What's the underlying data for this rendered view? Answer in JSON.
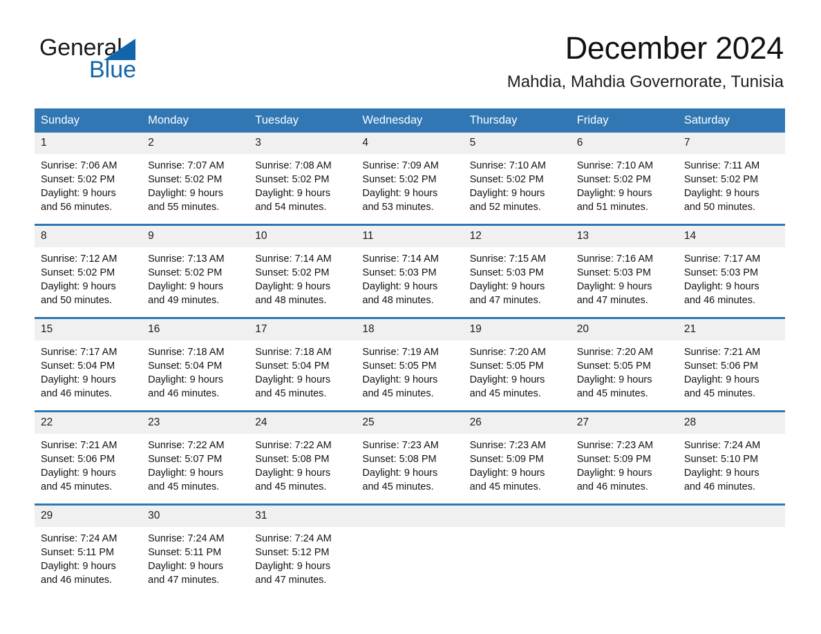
{
  "brand": {
    "word_one": "General",
    "word_two": "Blue",
    "accent_color": "#1166ab",
    "triangle_icon": "brand-triangle-icon"
  },
  "header": {
    "month_title": "December 2024",
    "location": "Mahdia, Mahdia Governorate, Tunisia"
  },
  "theme": {
    "header_blue": "#3077b4",
    "row_border_blue": "#2e76b4",
    "daynum_band": "#f0f0f0",
    "page_background": "#ffffff"
  },
  "calendar": {
    "weekday_headers": [
      "Sunday",
      "Monday",
      "Tuesday",
      "Wednesday",
      "Thursday",
      "Friday",
      "Saturday"
    ],
    "weeks": [
      [
        {
          "day": "1",
          "sunrise": "Sunrise: 7:06 AM",
          "sunset": "Sunset: 5:02 PM",
          "daylight_line1": "Daylight: 9 hours",
          "daylight_line2": "and 56 minutes."
        },
        {
          "day": "2",
          "sunrise": "Sunrise: 7:07 AM",
          "sunset": "Sunset: 5:02 PM",
          "daylight_line1": "Daylight: 9 hours",
          "daylight_line2": "and 55 minutes."
        },
        {
          "day": "3",
          "sunrise": "Sunrise: 7:08 AM",
          "sunset": "Sunset: 5:02 PM",
          "daylight_line1": "Daylight: 9 hours",
          "daylight_line2": "and 54 minutes."
        },
        {
          "day": "4",
          "sunrise": "Sunrise: 7:09 AM",
          "sunset": "Sunset: 5:02 PM",
          "daylight_line1": "Daylight: 9 hours",
          "daylight_line2": "and 53 minutes."
        },
        {
          "day": "5",
          "sunrise": "Sunrise: 7:10 AM",
          "sunset": "Sunset: 5:02 PM",
          "daylight_line1": "Daylight: 9 hours",
          "daylight_line2": "and 52 minutes."
        },
        {
          "day": "6",
          "sunrise": "Sunrise: 7:10 AM",
          "sunset": "Sunset: 5:02 PM",
          "daylight_line1": "Daylight: 9 hours",
          "daylight_line2": "and 51 minutes."
        },
        {
          "day": "7",
          "sunrise": "Sunrise: 7:11 AM",
          "sunset": "Sunset: 5:02 PM",
          "daylight_line1": "Daylight: 9 hours",
          "daylight_line2": "and 50 minutes."
        }
      ],
      [
        {
          "day": "8",
          "sunrise": "Sunrise: 7:12 AM",
          "sunset": "Sunset: 5:02 PM",
          "daylight_line1": "Daylight: 9 hours",
          "daylight_line2": "and 50 minutes."
        },
        {
          "day": "9",
          "sunrise": "Sunrise: 7:13 AM",
          "sunset": "Sunset: 5:02 PM",
          "daylight_line1": "Daylight: 9 hours",
          "daylight_line2": "and 49 minutes."
        },
        {
          "day": "10",
          "sunrise": "Sunrise: 7:14 AM",
          "sunset": "Sunset: 5:02 PM",
          "daylight_line1": "Daylight: 9 hours",
          "daylight_line2": "and 48 minutes."
        },
        {
          "day": "11",
          "sunrise": "Sunrise: 7:14 AM",
          "sunset": "Sunset: 5:03 PM",
          "daylight_line1": "Daylight: 9 hours",
          "daylight_line2": "and 48 minutes."
        },
        {
          "day": "12",
          "sunrise": "Sunrise: 7:15 AM",
          "sunset": "Sunset: 5:03 PM",
          "daylight_line1": "Daylight: 9 hours",
          "daylight_line2": "and 47 minutes."
        },
        {
          "day": "13",
          "sunrise": "Sunrise: 7:16 AM",
          "sunset": "Sunset: 5:03 PM",
          "daylight_line1": "Daylight: 9 hours",
          "daylight_line2": "and 47 minutes."
        },
        {
          "day": "14",
          "sunrise": "Sunrise: 7:17 AM",
          "sunset": "Sunset: 5:03 PM",
          "daylight_line1": "Daylight: 9 hours",
          "daylight_line2": "and 46 minutes."
        }
      ],
      [
        {
          "day": "15",
          "sunrise": "Sunrise: 7:17 AM",
          "sunset": "Sunset: 5:04 PM",
          "daylight_line1": "Daylight: 9 hours",
          "daylight_line2": "and 46 minutes."
        },
        {
          "day": "16",
          "sunrise": "Sunrise: 7:18 AM",
          "sunset": "Sunset: 5:04 PM",
          "daylight_line1": "Daylight: 9 hours",
          "daylight_line2": "and 46 minutes."
        },
        {
          "day": "17",
          "sunrise": "Sunrise: 7:18 AM",
          "sunset": "Sunset: 5:04 PM",
          "daylight_line1": "Daylight: 9 hours",
          "daylight_line2": "and 45 minutes."
        },
        {
          "day": "18",
          "sunrise": "Sunrise: 7:19 AM",
          "sunset": "Sunset: 5:05 PM",
          "daylight_line1": "Daylight: 9 hours",
          "daylight_line2": "and 45 minutes."
        },
        {
          "day": "19",
          "sunrise": "Sunrise: 7:20 AM",
          "sunset": "Sunset: 5:05 PM",
          "daylight_line1": "Daylight: 9 hours",
          "daylight_line2": "and 45 minutes."
        },
        {
          "day": "20",
          "sunrise": "Sunrise: 7:20 AM",
          "sunset": "Sunset: 5:05 PM",
          "daylight_line1": "Daylight: 9 hours",
          "daylight_line2": "and 45 minutes."
        },
        {
          "day": "21",
          "sunrise": "Sunrise: 7:21 AM",
          "sunset": "Sunset: 5:06 PM",
          "daylight_line1": "Daylight: 9 hours",
          "daylight_line2": "and 45 minutes."
        }
      ],
      [
        {
          "day": "22",
          "sunrise": "Sunrise: 7:21 AM",
          "sunset": "Sunset: 5:06 PM",
          "daylight_line1": "Daylight: 9 hours",
          "daylight_line2": "and 45 minutes."
        },
        {
          "day": "23",
          "sunrise": "Sunrise: 7:22 AM",
          "sunset": "Sunset: 5:07 PM",
          "daylight_line1": "Daylight: 9 hours",
          "daylight_line2": "and 45 minutes."
        },
        {
          "day": "24",
          "sunrise": "Sunrise: 7:22 AM",
          "sunset": "Sunset: 5:08 PM",
          "daylight_line1": "Daylight: 9 hours",
          "daylight_line2": "and 45 minutes."
        },
        {
          "day": "25",
          "sunrise": "Sunrise: 7:23 AM",
          "sunset": "Sunset: 5:08 PM",
          "daylight_line1": "Daylight: 9 hours",
          "daylight_line2": "and 45 minutes."
        },
        {
          "day": "26",
          "sunrise": "Sunrise: 7:23 AM",
          "sunset": "Sunset: 5:09 PM",
          "daylight_line1": "Daylight: 9 hours",
          "daylight_line2": "and 45 minutes."
        },
        {
          "day": "27",
          "sunrise": "Sunrise: 7:23 AM",
          "sunset": "Sunset: 5:09 PM",
          "daylight_line1": "Daylight: 9 hours",
          "daylight_line2": "and 46 minutes."
        },
        {
          "day": "28",
          "sunrise": "Sunrise: 7:24 AM",
          "sunset": "Sunset: 5:10 PM",
          "daylight_line1": "Daylight: 9 hours",
          "daylight_line2": "and 46 minutes."
        }
      ],
      [
        {
          "day": "29",
          "sunrise": "Sunrise: 7:24 AM",
          "sunset": "Sunset: 5:11 PM",
          "daylight_line1": "Daylight: 9 hours",
          "daylight_line2": "and 46 minutes."
        },
        {
          "day": "30",
          "sunrise": "Sunrise: 7:24 AM",
          "sunset": "Sunset: 5:11 PM",
          "daylight_line1": "Daylight: 9 hours",
          "daylight_line2": "and 47 minutes."
        },
        {
          "day": "31",
          "sunrise": "Sunrise: 7:24 AM",
          "sunset": "Sunset: 5:12 PM",
          "daylight_line1": "Daylight: 9 hours",
          "daylight_line2": "and 47 minutes."
        },
        {
          "day": "",
          "sunrise": "",
          "sunset": "",
          "daylight_line1": "",
          "daylight_line2": ""
        },
        {
          "day": "",
          "sunrise": "",
          "sunset": "",
          "daylight_line1": "",
          "daylight_line2": ""
        },
        {
          "day": "",
          "sunrise": "",
          "sunset": "",
          "daylight_line1": "",
          "daylight_line2": ""
        },
        {
          "day": "",
          "sunrise": "",
          "sunset": "",
          "daylight_line1": "",
          "daylight_line2": ""
        }
      ]
    ]
  }
}
